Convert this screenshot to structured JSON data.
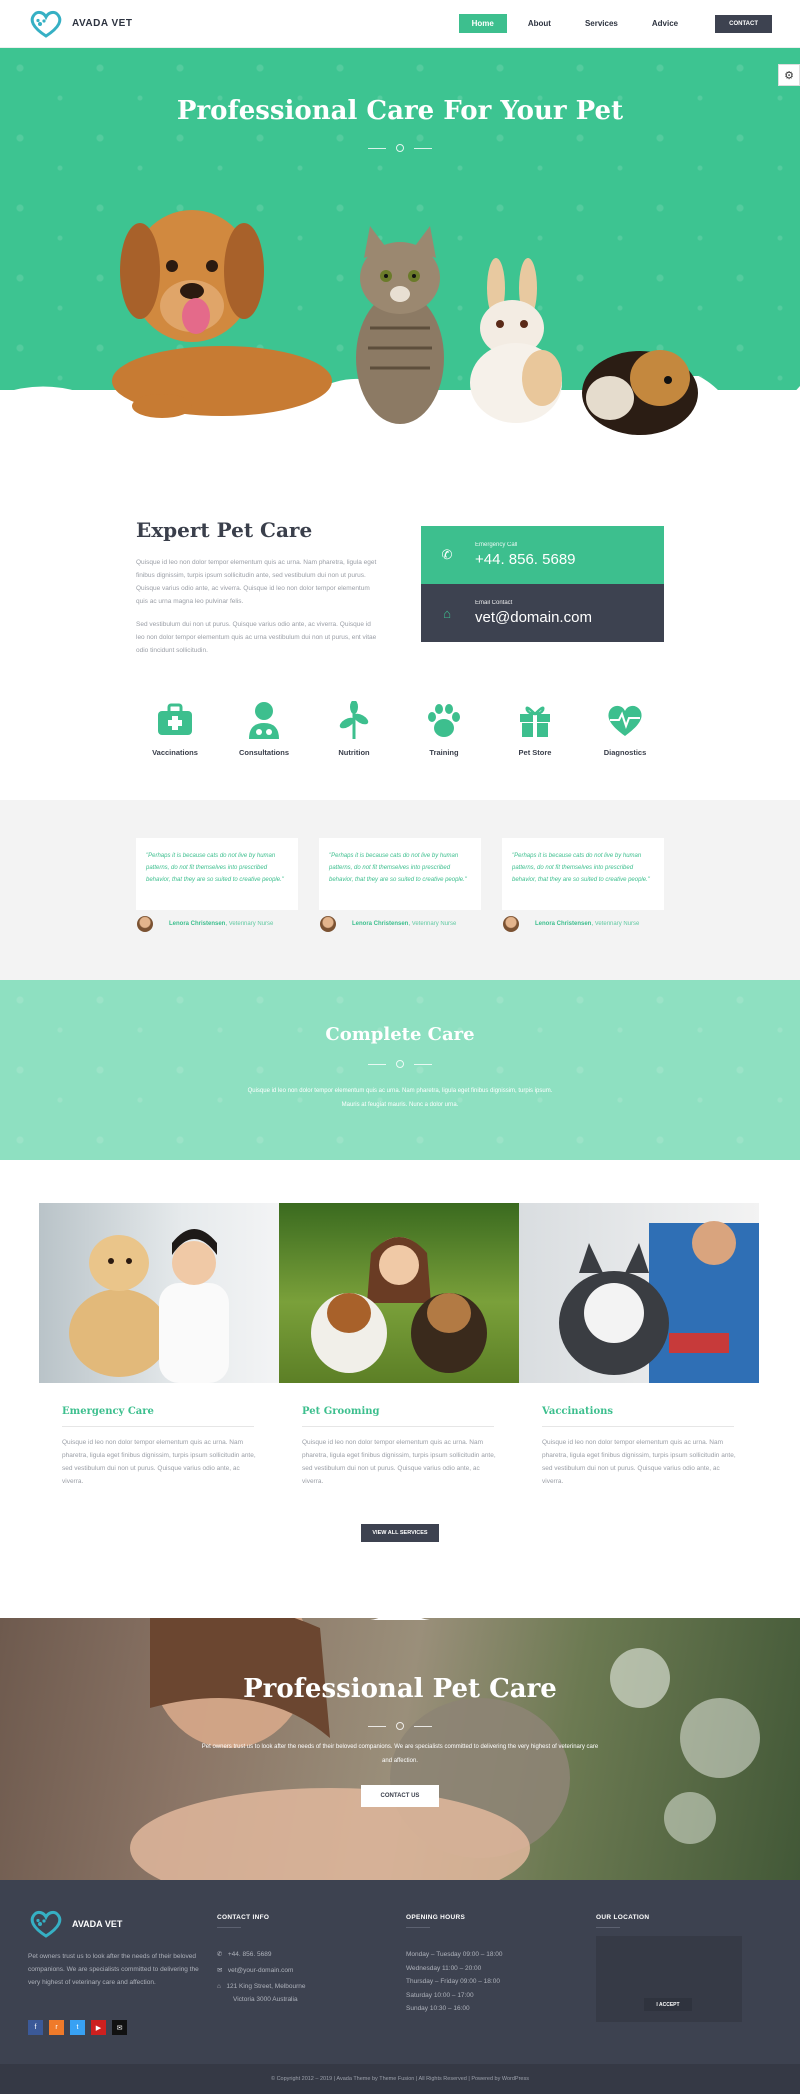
{
  "header": {
    "brand": "AVADA VET",
    "nav": [
      {
        "label": "Home",
        "active": true
      },
      {
        "label": "About",
        "active": false
      },
      {
        "label": "Services",
        "active": false
      },
      {
        "label": "Advice",
        "active": false
      }
    ],
    "contact_button": "CONTACT"
  },
  "hero": {
    "title": "Professional Care For Your Pet"
  },
  "expert": {
    "title": "Expert Pet Care",
    "paragraph1": "Quisque id leo non dolor tempor elementum quis ac urna. Nam pharetra, ligula eget finibus dignissim, turpis ipsum sollicitudin ante, sed vestibulum dui non ut purus. Quisque varius odio ante, ac viverra. Quisque id leo non dolor tempor elementum quis ac urna magna leo pulvinar felis.",
    "paragraph2": "Sed vestibulum dui non ut purus. Quisque varius odio ante, ac viverra. Quisque id leo non dolor tempor elementum quis ac urna vestibulum dui non ut purus, ent vitae odio tincidunt sollicitudin."
  },
  "contact_boxes": [
    {
      "label": "Emergency Call",
      "value": "+44. 856. 5689",
      "icon": "phone-icon",
      "color": "#3dbf8e"
    },
    {
      "label": "Email Contact",
      "value": "vet@domain.com",
      "icon": "home-icon",
      "color": "#3d4250"
    }
  ],
  "services": [
    {
      "label": "Vaccinations",
      "icon": "medical-kit-icon"
    },
    {
      "label": "Consultations",
      "icon": "doctor-icon"
    },
    {
      "label": "Nutrition",
      "icon": "leaf-icon"
    },
    {
      "label": "Training",
      "icon": "paw-icon"
    },
    {
      "label": "Pet Store",
      "icon": "gift-icon"
    },
    {
      "label": "Diagnostics",
      "icon": "heartbeat-icon"
    }
  ],
  "testimonials": [
    {
      "quote": "\"Perhaps it is because cats do not live by human patterns, do not fit themselves into prescribed behavior, that they are so suited to creative people.\"",
      "name": "Lenora Christensen",
      "role": "Veterinary Nurse"
    },
    {
      "quote": "\"Perhaps it is because cats do not live by human patterns, do not fit themselves into prescribed behavior, that they are so suited to creative people.\"",
      "name": "Lenora Christensen",
      "role": "Veterinary Nurse"
    },
    {
      "quote": "\"Perhaps it is because cats do not live by human patterns, do not fit themselves into prescribed behavior, that they are so suited to creative people.\"",
      "name": "Lenora Christensen",
      "role": "Veterinary Nurse"
    }
  ],
  "complete_care": {
    "title": "Complete Care",
    "text": "Quisque id leo non dolor tempor elementum quis ac urna. Nam pharetra, ligula eget finibus dignissim, turpis ipsum. Mauris at feugiat mauris. Nunc a dolor urna."
  },
  "care_cards": [
    {
      "title": "Emergency Care",
      "text": "Quisque id leo non dolor tempor elementum quis ac urna. Nam pharetra, ligula eget finibus dignissim, turpis ipsum sollicitudin ante, sed vestibulum dui non ut purus. Quisque varius odio ante, ac viverra."
    },
    {
      "title": "Pet Grooming",
      "text": "Quisque id leo non dolor tempor elementum quis ac urna. Nam pharetra, ligula eget finibus dignissim, turpis ipsum sollicitudin ante, sed vestibulum dui non ut purus. Quisque varius odio ante, ac viverra."
    },
    {
      "title": "Vaccinations",
      "text": "Quisque id leo non dolor tempor elementum quis ac urna. Nam pharetra, ligula eget finibus dignissim, turpis ipsum sollicitudin ante, sed vestibulum dui non ut purus. Quisque varius odio ante, ac viverra."
    }
  ],
  "view_all_button": "VIEW ALL SERVICES",
  "banner": {
    "title": "Professional Pet Care",
    "text": "Pet owners trust us to look after the needs of their beloved companions. We are specialists committed to delivering the very highest of veterinary care and affection.",
    "button": "CONTACT US"
  },
  "footer": {
    "brand": "AVADA VET",
    "about": "Pet owners trust us to look after the needs of their beloved companions. We are specialists committed to delivering the very highest of veterinary care and affection.",
    "contact_title": "CONTACT INFO",
    "phone": "+44. 856. 5689",
    "email": "vet@your-domain.com",
    "address_line1": "121 King Street, Melbourne",
    "address_line2": "Victoria 3000 Australia",
    "hours_title": "OPENING HOURS",
    "hours": [
      "Monday – Tuesday 09:00 – 18:00",
      "Wednesday 11:00 – 20:00",
      "Thursday – Friday 09:00 – 18:00",
      "Saturday 10:00 – 17:00",
      "Sunday 10:30 – 16:00"
    ],
    "location_title": "OUR LOCATION",
    "accept_button": "I ACCEPT",
    "social": [
      {
        "icon": "facebook-icon",
        "color": "#3b5998",
        "glyph": "f"
      },
      {
        "icon": "rss-icon",
        "color": "#ef7a2a",
        "glyph": "r"
      },
      {
        "icon": "twitter-icon",
        "color": "#38a1f3",
        "glyph": "t"
      },
      {
        "icon": "youtube-icon",
        "color": "#cd201f",
        "glyph": "▶"
      },
      {
        "icon": "email-icon",
        "color": "#111111",
        "glyph": "✉"
      }
    ]
  },
  "copyright": "© Copyright 2012 – 2019   |   Avada Theme by Theme Fusion   |   All Rights Reserved   |   Powered by WordPress",
  "colors": {
    "accent": "#3dbf8e",
    "dark": "#3d4250",
    "band": "#8ee0c1"
  }
}
